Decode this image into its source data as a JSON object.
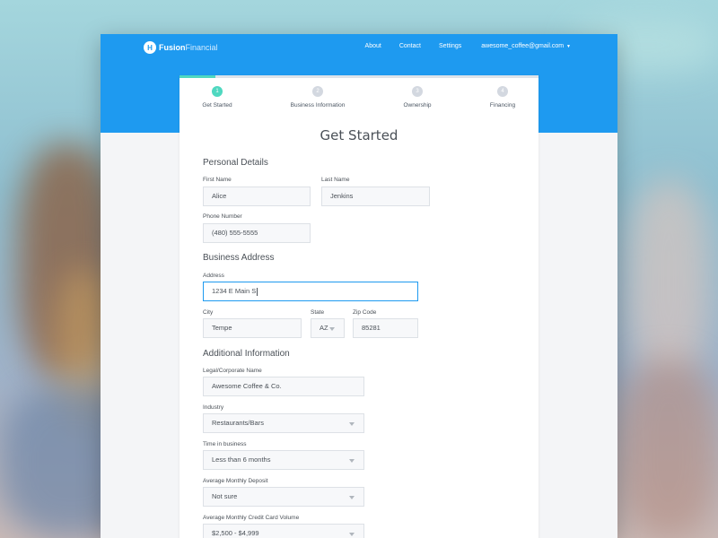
{
  "brand": {
    "bold": "Fusion",
    "light": "Financial",
    "mark": "H"
  },
  "nav": {
    "items": [
      "About",
      "Contact",
      "Settings"
    ],
    "user": "awesome_coffee@gmail.com",
    "user_caret": "▼"
  },
  "progress": {
    "fraction": 0.1
  },
  "steps": [
    {
      "num": "1",
      "label": "Get Started",
      "active": true
    },
    {
      "num": "2",
      "label": "Business Information",
      "active": false
    },
    {
      "num": "3",
      "label": "Ownership",
      "active": false
    },
    {
      "num": "4",
      "label": "Financing",
      "active": false
    }
  ],
  "form": {
    "title": "Get Started",
    "personal": {
      "heading": "Personal Details",
      "first_name_label": "First Name",
      "first_name": "Alice",
      "last_name_label": "Last Name",
      "last_name": "Jenkins",
      "phone_label": "Phone Number",
      "phone": "(480) 555-5555"
    },
    "address": {
      "heading": "Business Address",
      "address_label": "Address",
      "address": "1234 E Main S",
      "city_label": "City",
      "city": "Tempe",
      "state_label": "State",
      "state": "AZ",
      "zip_label": "Zip Code",
      "zip": "85281"
    },
    "additional": {
      "heading": "Additional Information",
      "legal_label": "Legal/Corporate Name",
      "legal": "Awesome Coffee & Co.",
      "industry_label": "Industry",
      "industry": "Restaurants/Bars",
      "time_label": "Time in business",
      "time": "Less than 6 months",
      "deposit_label": "Average Monthly Deposit",
      "deposit": "Not sure",
      "cc_label": "Average Monthly Credit Card Volume",
      "cc": "$2,500 - $4,999"
    }
  },
  "colors": {
    "primary": "#1e9af0",
    "accent": "#4fd8c0"
  }
}
